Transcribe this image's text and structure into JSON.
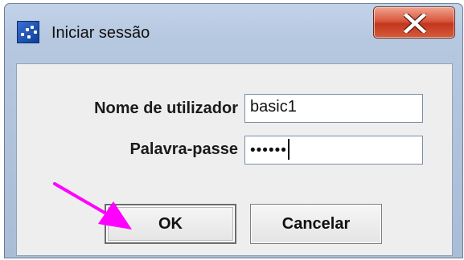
{
  "window": {
    "title": "Iniciar sessão",
    "app_icon": "app-dots-icon",
    "close_icon": "close-icon"
  },
  "form": {
    "username_label": "Nome de utilizador",
    "username_value": "basic1",
    "password_label": "Palavra-passe",
    "password_value": "••••••"
  },
  "buttons": {
    "ok_label": "OK",
    "cancel_label": "Cancelar"
  },
  "annotation": {
    "arrow_icon": "pointer-arrow-icon",
    "arrow_color": "#ff00ff"
  },
  "colors": {
    "close_button": "#d04a30",
    "title_bar": "#b6c8e0",
    "dialog_background": "#eeeeee"
  }
}
